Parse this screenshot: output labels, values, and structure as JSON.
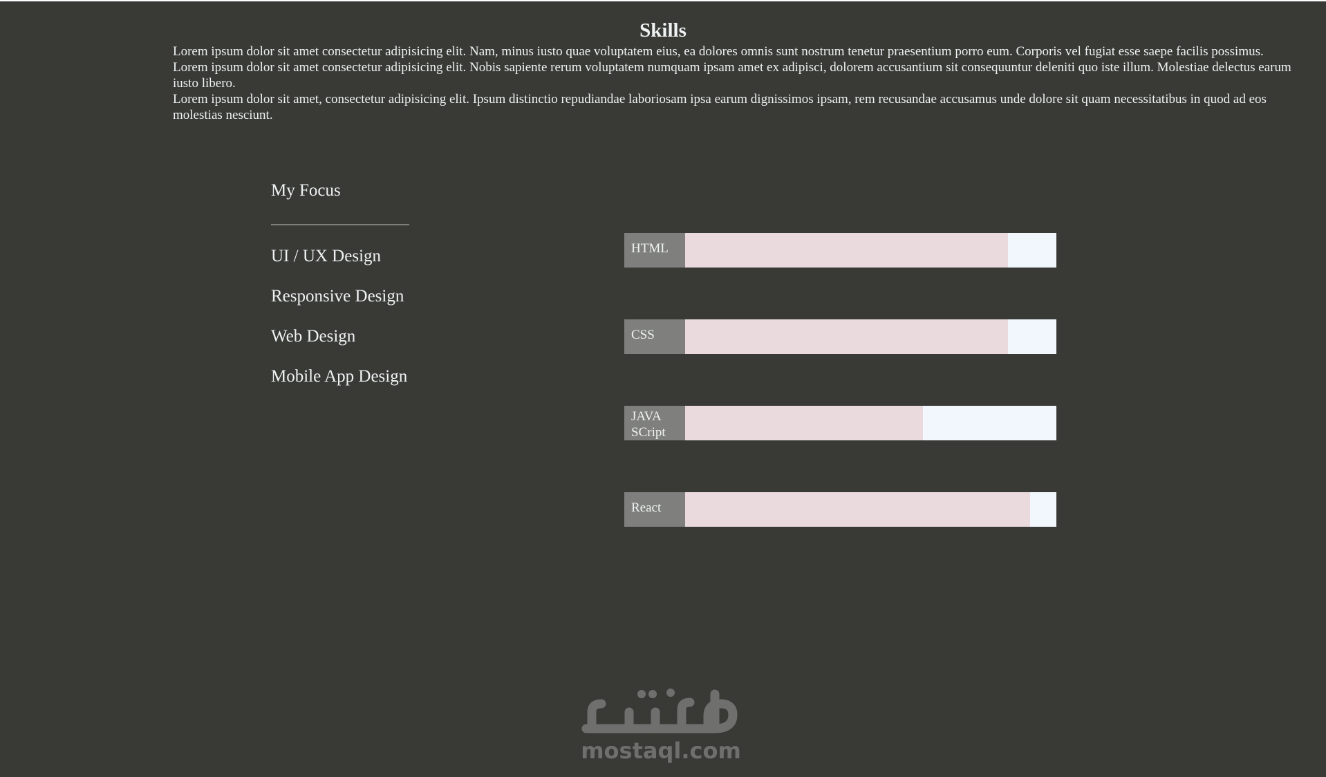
{
  "title": "Skills",
  "intro": [
    "Lorem ipsum dolor sit amet consectetur adipisicing elit. Nam, minus iusto quae voluptatem eius, ea dolores omnis sunt nostrum tenetur praesentium porro eum. Corporis vel fugiat esse saepe facilis possimus.",
    "Lorem ipsum dolor sit amet consectetur adipisicing elit. Nobis sapiente rerum voluptatem numquam ipsam amet ex adipisci, dolorem accusantium sit consequuntur deleniti quo iste illum. Molestiae delectus earum iusto libero.",
    "Lorem ipsum dolor sit amet, consectetur adipisicing elit. Ipsum distinctio repudiandae laboriosam ipsa earum dignissimos ipsam, rem recusandae accusamus unde dolore sit quam necessitatibus in quod ad eos molestias nesciunt."
  ],
  "focus": {
    "heading": "My Focus",
    "items": [
      "UI / UX Design",
      "Responsive Design",
      "Web Design",
      "Mobile App Design"
    ]
  },
  "skills": [
    {
      "label": "HTML",
      "level": 0.87
    },
    {
      "label": "CSS",
      "level": 0.87
    },
    {
      "label": "JAVA SCript",
      "level": 0.64
    },
    {
      "label": "React",
      "level": 0.93
    }
  ],
  "logo": {
    "arabic": "مستقل",
    "text": "mostaql.com"
  },
  "colors": {
    "background": "#393a36",
    "text": "#eef2f2",
    "skill_label_bg": "#7f807e",
    "skill_fill": "#eadadd",
    "skill_track": "#f1f7fd",
    "logo": "#6f706d"
  }
}
